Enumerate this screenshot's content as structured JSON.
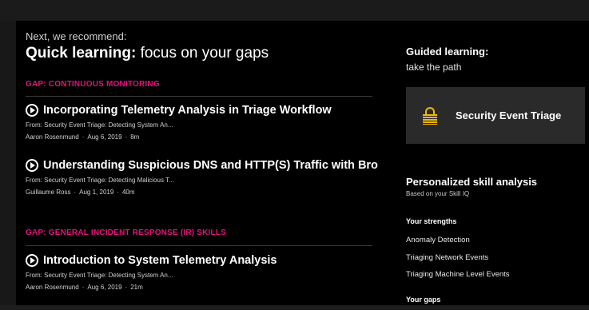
{
  "left": {
    "eyebrow": "Next, we recommend:",
    "headline_strong": "Quick learning:",
    "headline_rest": " focus on your gaps",
    "sections": [
      {
        "gap_label": "GAP: CONTINUOUS MONITORING",
        "courses": [
          {
            "title": "Incorporating Telemetry Analysis in Triage Workflow",
            "from": "From: Security Event Triage: Detecting System An...",
            "author": "Aaron Rosenmund",
            "date": "Aug 6, 2019",
            "duration": "8m"
          },
          {
            "title": "Understanding Suspicious DNS and HTTP(S) Traffic with Bro",
            "from": "From: Security Event Triage: Detecting Malicious T...",
            "author": "Guillaume Ross",
            "date": "Aug 1, 2019",
            "duration": "40m"
          }
        ]
      },
      {
        "gap_label": "GAP: GENERAL INCIDENT RESPONSE (IR) SKILLS",
        "courses": [
          {
            "title": "Introduction to System Telemetry Analysis",
            "from": "From: Security Event Triage: Detecting System An...",
            "author": "Aaron Rosenmund",
            "date": "Aug 6, 2019",
            "duration": "21m"
          }
        ]
      }
    ],
    "meta_separator": "·"
  },
  "right": {
    "guided_title": "Guided learning:",
    "guided_sub": "take the path",
    "path_card_label": "Security Event Triage",
    "path_card_icon": "lock-icon",
    "skill_title": "Personalized skill analysis",
    "skill_sub": "Based on your Skill IQ",
    "strengths_title": "Your strengths",
    "strengths": [
      "Anomaly Detection",
      "Triaging Network Events",
      "Triaging Machine Level Events"
    ],
    "gaps_title": "Your gaps"
  },
  "colors": {
    "gap_accent": "#e0147a",
    "lock_accent": "#f2b705",
    "panel_bg": "#000000",
    "card_bg": "#2a2a2a"
  }
}
